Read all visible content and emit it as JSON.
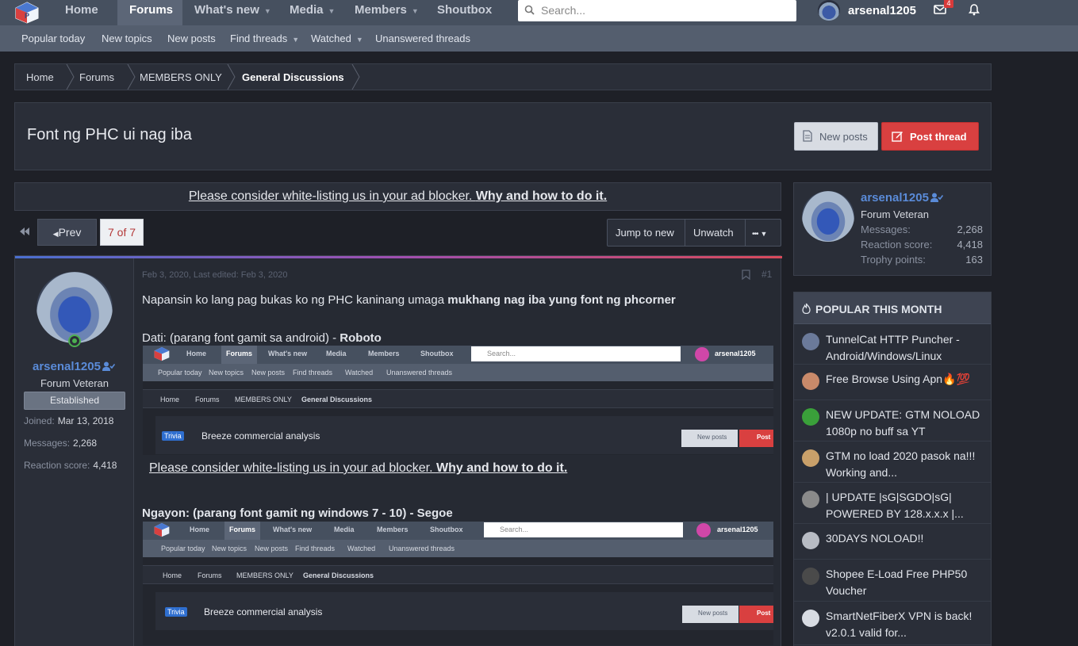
{
  "nav": {
    "tabs": [
      {
        "label": "Home"
      },
      {
        "label": "Forums"
      },
      {
        "label": "What's new"
      },
      {
        "label": "Media"
      },
      {
        "label": "Members"
      },
      {
        "label": "Shoutbox"
      }
    ],
    "search_placeholder": "Search...",
    "username": "arsenal1205",
    "inbox_count": "4"
  },
  "subnav": {
    "items": [
      {
        "label": "Popular today"
      },
      {
        "label": "New topics"
      },
      {
        "label": "New posts"
      },
      {
        "label": "Find threads"
      },
      {
        "label": "Watched"
      },
      {
        "label": "Unanswered threads"
      }
    ]
  },
  "breadcrumb": [
    "Home",
    "Forums",
    "MEMBERS ONLY",
    "General Discussions"
  ],
  "thread": {
    "title": "Font ng PHC ui nag iba",
    "new_posts_label": "New posts",
    "post_thread_label": "Post thread"
  },
  "ad_notice": {
    "text": "Please consider white-listing us in your ad blocker. ",
    "link": "Why and how to do it."
  },
  "pagination": {
    "prev_label": "Prev",
    "current": "7 of 7"
  },
  "actions": {
    "jump_label": "Jump to new",
    "unwatch_label": "Unwatch",
    "more_label": "•••"
  },
  "post": {
    "author": "arsenal1205",
    "author_title": "Forum Veteran",
    "banner": "Established",
    "joined_label": "Joined:",
    "joined": "Mar 13, 2018",
    "messages_label": "Messages:",
    "messages": "2,268",
    "reaction_label": "Reaction score:",
    "reaction": "4,418",
    "meta": "Feb 3, 2020, Last edited: Feb 3, 2020",
    "number": "#1",
    "line1_normal": "Napansin ko lang pag bukas ko ng PHC kaninang umaga ",
    "line1_bold": "mukhang nag iba yung font ng phcorner",
    "line2_normal": "Dati: (parang font gamit sa android) - ",
    "line2_bold": "Roboto",
    "line3": "Ngayon: (parang font gamit ng windows 7 - 10) - Segoe",
    "embed_notice_text": "Please consider white-listing us in your ad blocker. ",
    "embed_notice_link": "Why and how to do it."
  },
  "embedded": {
    "tabs": [
      "Home",
      "Forums",
      "What's new",
      "Media",
      "Members",
      "Shoutbox"
    ],
    "search": "Search...",
    "username": "arsenal1205",
    "sub": [
      "Popular today",
      "New topics",
      "New posts",
      "Find threads",
      "Watched",
      "Unanswered threads"
    ],
    "crumbs": [
      "Home",
      "Forums",
      "MEMBERS ONLY",
      "General Discussions"
    ],
    "trivia": "Trivia",
    "title": "Breeze commercial analysis",
    "new_posts": "New posts",
    "post": "Post"
  },
  "sidebar_user": {
    "name": "arsenal1205",
    "role": "Forum Veteran",
    "messages_label": "Messages:",
    "messages": "2,268",
    "reaction_label": "Reaction score:",
    "reaction": "4,418",
    "trophy_label": "Trophy points:",
    "trophy": "163"
  },
  "popular": {
    "heading": "POPULAR THIS MONTH",
    "items": [
      {
        "title": "TunnelCat HTTP Puncher - Android/Windows/Linux",
        "color": "#6b7a9a"
      },
      {
        "title": "Free Browse Using Apn🔥💯",
        "color": "#c98a6a"
      },
      {
        "title": "NEW UPDATE: GTM NOLOAD 1080p no buff sa YT",
        "color": "#3aa03a"
      },
      {
        "title": "GTM no load 2020 pasok na!!! Working and...",
        "color": "#c9a06a"
      },
      {
        "title": "| UPDATE |sG|SGDO|sG| POWERED BY 128.x.x.x |...",
        "color": "#8a8a8a"
      },
      {
        "title": "30DAYS NOLOAD!!",
        "color": "#b8bcc4"
      },
      {
        "title": "Shopee E-Load Free PHP50 Voucher",
        "color": "#4a4a4a"
      },
      {
        "title": "SmartNetFiberX VPN is back! v2.0.1 valid for...",
        "color": "#d8dce3"
      }
    ]
  },
  "colors": {
    "accent_link": "#5a8bd8",
    "post_button": "#d94040",
    "nav_bg": "#46505f"
  }
}
